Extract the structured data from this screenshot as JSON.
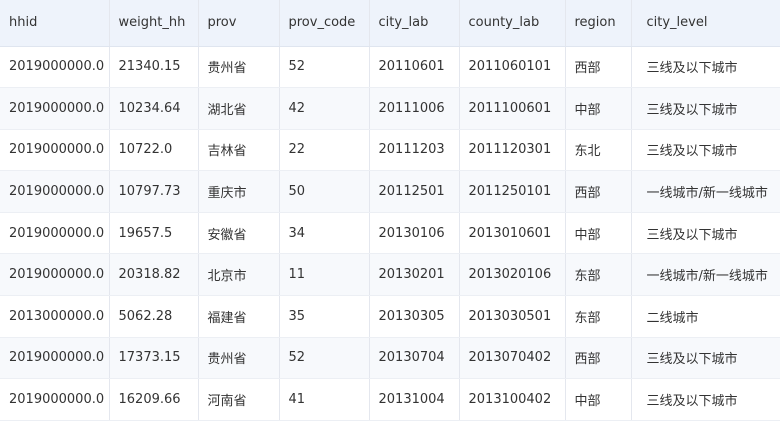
{
  "table": {
    "columns": [
      "hhid",
      "weight_hh",
      "prov",
      "prov_code",
      "city_lab",
      "county_lab",
      "region",
      "city_level"
    ],
    "rows": [
      [
        "2019000000.0",
        "21340.15",
        "贵州省",
        "52",
        "20110601",
        "2011060101",
        "西部",
        "三线及以下城市"
      ],
      [
        "2019000000.0",
        "10234.64",
        "湖北省",
        "42",
        "20111006",
        "2011100601",
        "中部",
        "三线及以下城市"
      ],
      [
        "2019000000.0",
        "10722.0",
        "吉林省",
        "22",
        "20111203",
        "2011120301",
        "东北",
        "三线及以下城市"
      ],
      [
        "2019000000.0",
        "10797.73",
        "重庆市",
        "50",
        "20112501",
        "2011250101",
        "西部",
        "一线城市/新一线城市"
      ],
      [
        "2019000000.0",
        "19657.5",
        "安徽省",
        "34",
        "20130106",
        "2013010601",
        "中部",
        "三线及以下城市"
      ],
      [
        "2019000000.0",
        "20318.82",
        "北京市",
        "11",
        "20130201",
        "2013020106",
        "东部",
        "一线城市/新一线城市"
      ],
      [
        "2013000000.0",
        "5062.28",
        "福建省",
        "35",
        "20130305",
        "2013030501",
        "东部",
        "二线城市"
      ],
      [
        "2019000000.0",
        "17373.15",
        "贵州省",
        "52",
        "20130704",
        "2013070402",
        "西部",
        "三线及以下城市"
      ],
      [
        "2019000000.0",
        "16209.66",
        "河南省",
        "41",
        "20131004",
        "2013100402",
        "中部",
        "三线及以下城市"
      ]
    ]
  }
}
